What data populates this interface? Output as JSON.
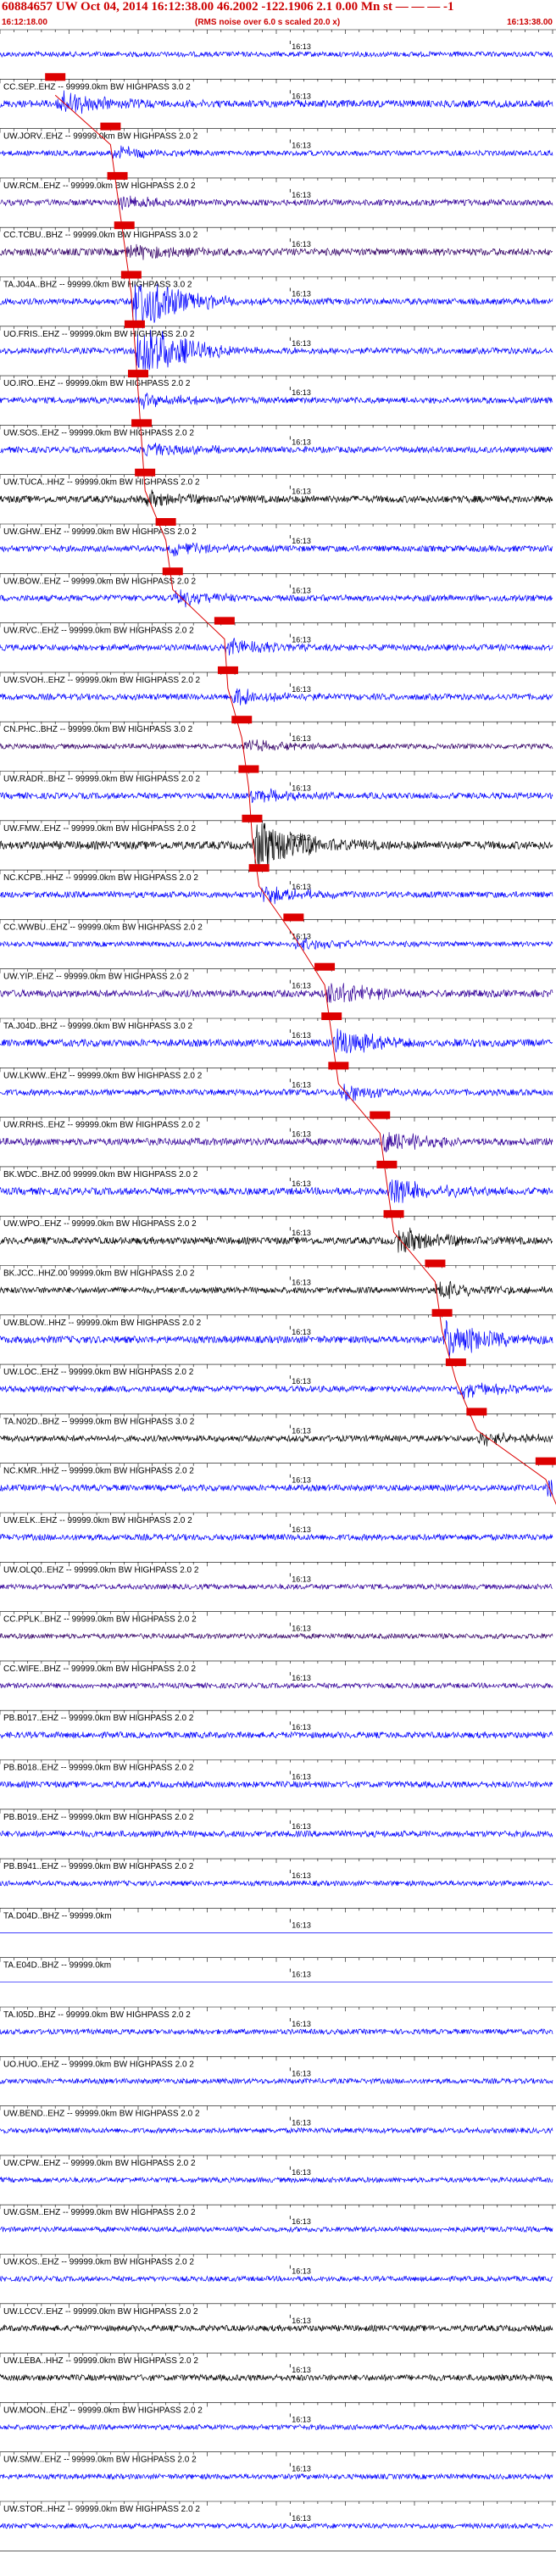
{
  "header": {
    "title": "60884657 UW Oct 04, 2014 16:12:38.00   46.2002 -122.1906  2.1 0.00 Mn st — — — -1",
    "start_time": "16:12:18.00",
    "rms_note": "(RMS noise over 6.0 s scaled 20.0 x)",
    "end_time": "16:13:38.00"
  },
  "chart_data": {
    "type": "line",
    "time_marker_label": "16:13",
    "x_range_seconds": [
      0,
      80
    ],
    "traces": [
      {
        "label": "",
        "color": "#0000ff",
        "amp": 0.25,
        "pick": null,
        "event": 0.9
      },
      {
        "label": "CC.SEP..EHZ -- 99999.0km BW  HIGHPASS  3.0  2",
        "color": "#0000ff",
        "amp": 0.35,
        "pick": 8.0,
        "event": 1.2
      },
      {
        "label": "UW.JORV..EHZ -- 99999.0km BW  HIGHPASS  2.0  2",
        "color": "#0000ff",
        "amp": 0.25,
        "pick": 16.0,
        "event": 0.7
      },
      {
        "label": "UW.RCM..EHZ -- 99999.0km BW  HIGHPASS  2.0  2",
        "color": "#330099",
        "amp": 0.3,
        "pick": 17.0,
        "event": 0.6
      },
      {
        "label": "CC.TCBU..BHZ -- 99999.0km BW  HIGHPASS  3.0  2",
        "color": "#330066",
        "amp": 0.35,
        "pick": 18.0,
        "event": 0.8
      },
      {
        "label": "TA.J04A..BHZ -- 99999.0km BW  HIGHPASS  3.0  2",
        "color": "#0000ff",
        "amp": 0.3,
        "pick": 19.0,
        "event": 3.0
      },
      {
        "label": "UO.FRIS..EHZ -- 99999.0km BW  HIGHPASS  2.0  2",
        "color": "#0000ff",
        "amp": 0.3,
        "pick": 19.5,
        "event": 3.0
      },
      {
        "label": "UO.IRO..EHZ -- 99999.0km BW  HIGHPASS  2.0  2",
        "color": "#0000ff",
        "amp": 0.3,
        "pick": 20.0,
        "event": 0.7
      },
      {
        "label": "UW.SOS..EHZ -- 99999.0km BW  HIGHPASS  2.0  2",
        "color": "#0000ff",
        "amp": 0.3,
        "pick": 20.5,
        "event": 0.8
      },
      {
        "label": "UW.TUCA..HHZ -- 99999.0km BW  HIGHPASS  2.0  2",
        "color": "#000000",
        "amp": 0.35,
        "pick": 21.0,
        "event": 0.8
      },
      {
        "label": "UW.GHW..EHZ -- 99999.0km BW  HIGHPASS  2.0  2",
        "color": "#0000ff",
        "amp": 0.3,
        "pick": 24.0,
        "event": 0.7
      },
      {
        "label": "UW.BOW..EHZ -- 99999.0km BW  HIGHPASS  2.0  2",
        "color": "#0000ff",
        "amp": 0.3,
        "pick": 25.0,
        "event": 0.8
      },
      {
        "label": "UW.RVC..EHZ -- 99999.0km BW  HIGHPASS  2.0  2",
        "color": "#0000ff",
        "amp": 0.3,
        "pick": 32.5,
        "event": 0.8
      },
      {
        "label": "UW.SVOH..EHZ -- 99999.0km BW  HIGHPASS  2.0  2",
        "color": "#0000ff",
        "amp": 0.3,
        "pick": 33.0,
        "event": 0.8
      },
      {
        "label": "CN.PHC..BHZ -- 99999.0km BW  HIGHPASS  3.0  2",
        "color": "#330066",
        "amp": 0.25,
        "pick": 35.0,
        "event": 0.6
      },
      {
        "label": "UW.RADR..BHZ -- 99999.0km BW  HIGHPASS  2.0  2",
        "color": "#0000ff",
        "amp": 0.3,
        "pick": 36.0,
        "event": 0.7
      },
      {
        "label": "UW.FMW..EHZ -- 99999.0km BW  HIGHPASS  2.0  2",
        "color": "#000000",
        "amp": 0.4,
        "pick": 36.5,
        "event": 2.8
      },
      {
        "label": "NC.KCPB..HHZ -- 99999.0km BW  HIGHPASS  2.0  2",
        "color": "#0000ff",
        "amp": 0.3,
        "pick": 37.5,
        "event": 0.8
      },
      {
        "label": "CC.WWBU..EHZ -- 99999.0km BW  HIGHPASS  2.0  2",
        "color": "#0000ff",
        "amp": 0.25,
        "pick": 42.5,
        "event": 0.6
      },
      {
        "label": "UW.YIP..EHZ -- 99999.0km BW  HIGHPASS  2.0  2",
        "color": "#330099",
        "amp": 0.35,
        "pick": 47.0,
        "event": 1.1
      },
      {
        "label": "TA.J04D..BHZ -- 99999.0km BW  HIGHPASS  3.0  2",
        "color": "#0000ff",
        "amp": 0.35,
        "pick": 48.0,
        "event": 1.4
      },
      {
        "label": "UW.LKWW..EHZ -- 99999.0km BW  HIGHPASS  2.0  2",
        "color": "#0000ff",
        "amp": 0.3,
        "pick": 49.0,
        "event": 0.8
      },
      {
        "label": "UW.RRHS..EHZ -- 99999.0km BW  HIGHPASS  2.0  2",
        "color": "#330099",
        "amp": 0.35,
        "pick": 55.0,
        "event": 1.1
      },
      {
        "label": "BK.WDC..BHZ.00 99999.0km BW  HIGHPASS  2.0  2",
        "color": "#0000ff",
        "amp": 0.35,
        "pick": 56.0,
        "event": 1.3
      },
      {
        "label": "UW.WPO..EHZ -- 99999.0km BW  HIGHPASS  2.0  2",
        "color": "#000000",
        "amp": 0.35,
        "pick": 57.0,
        "event": 1.4
      },
      {
        "label": "BK.JCC..HHZ.00 99999.0km BW  HIGHPASS  2.0  2",
        "color": "#000000",
        "amp": 0.3,
        "pick": 63.0,
        "event": 0.9
      },
      {
        "label": "UW.BLOW..HHZ -- 99999.0km BW  HIGHPASS  2.0  2",
        "color": "#0000ff",
        "amp": 0.35,
        "pick": 64.0,
        "event": 1.8
      },
      {
        "label": "UW.LOC..EHZ -- 99999.0km BW  HIGHPASS  2.0  2",
        "color": "#0000ff",
        "amp": 0.3,
        "pick": 66.0,
        "event": 0.8
      },
      {
        "label": "TA.N02D..BHZ -- 99999.0km BW  HIGHPASS  3.0  2",
        "color": "#000000",
        "amp": 0.3,
        "pick": 69.0,
        "event": 0.7
      },
      {
        "label": "NC.KMR..HHZ -- 99999.0km BW  HIGHPASS  2.0  2",
        "color": "#0000ff",
        "amp": 0.3,
        "pick": 79.0,
        "event": 1.0
      },
      {
        "label": "UW.ELK..EHZ -- 99999.0km BW  HIGHPASS  2.0  2",
        "color": "#0000ff",
        "amp": 0.3,
        "pick": 82.0,
        "event": 1.0
      },
      {
        "label": "UW.OLQ0..EHZ -- 99999.0km BW  HIGHPASS  2.0  2",
        "color": "#330099",
        "amp": 0.25,
        "pick": null,
        "event": 0.5
      },
      {
        "label": "CC.PPLK..BHZ -- 99999.0km BW  HIGHPASS  2.0  2",
        "color": "#330066",
        "amp": 0.25,
        "pick": null,
        "event": 0.5
      },
      {
        "label": "CC.WIFE..BHZ -- 99999.0km BW  HIGHPASS  2.0  2",
        "color": "#330099",
        "amp": 0.25,
        "pick": null,
        "event": 0.5
      },
      {
        "label": "PB.B017..EHZ -- 99999.0km BW  HIGHPASS  2.0  2",
        "color": "#0000ff",
        "amp": 0.3,
        "pick": null,
        "event": 0.5
      },
      {
        "label": "PB.B018..EHZ -- 99999.0km BW  HIGHPASS  2.0  2",
        "color": "#0000ff",
        "amp": 0.3,
        "pick": null,
        "event": 0.7
      },
      {
        "label": "PB.B019..EHZ -- 99999.0km BW  HIGHPASS  2.0  2",
        "color": "#0000ff",
        "amp": 0.3,
        "pick": null,
        "event": 0.5
      },
      {
        "label": "PB.B941..EHZ -- 99999.0km BW  HIGHPASS  2.0  2",
        "color": "#0000ff",
        "amp": 0.25,
        "pick": null,
        "event": 0.5
      },
      {
        "label": "TA.D04D..BHZ -- 99999.0km",
        "color": "#0000ff",
        "amp": 0.0,
        "pick": null,
        "event": 0
      },
      {
        "label": "TA.E04D..BHZ -- 99999.0km",
        "color": "#0000ff",
        "amp": 0.0,
        "pick": null,
        "event": 0
      },
      {
        "label": "TA.I05D..BHZ -- 99999.0km BW  HIGHPASS  2.0  2",
        "color": "#0000ff",
        "amp": 0.25,
        "pick": null,
        "event": 3.0
      },
      {
        "label": "UO.HUO..EHZ -- 99999.0km BW  HIGHPASS  2.0  2",
        "color": "#0000ff",
        "amp": 0.25,
        "pick": null,
        "event": 0.6
      },
      {
        "label": "UW.BEND..EHZ -- 99999.0km BW  HIGHPASS  2.0  2",
        "color": "#0000ff",
        "amp": 0.25,
        "pick": null,
        "event": 0.5
      },
      {
        "label": "UW.CPW..EHZ -- 99999.0km BW  HIGHPASS  2.0  2",
        "color": "#0000ff",
        "amp": 0.25,
        "pick": null,
        "event": 0.5
      },
      {
        "label": "UW.GSM..EHZ -- 99999.0km BW  HIGHPASS  2.0  2",
        "color": "#0000ff",
        "amp": 0.25,
        "pick": null,
        "event": 0.5
      },
      {
        "label": "UW.KOS..EHZ -- 99999.0km BW  HIGHPASS  2.0  2",
        "color": "#0000ff",
        "amp": 0.25,
        "pick": null,
        "event": 0.5
      },
      {
        "label": "UW.LCCV..EHZ -- 99999.0km BW  HIGHPASS  2.0  2",
        "color": "#000000",
        "amp": 0.3,
        "pick": null,
        "event": 0.5
      },
      {
        "label": "UW.LEBA..HHZ -- 99999.0km BW  HIGHPASS  2.0  2",
        "color": "#000000",
        "amp": 0.3,
        "pick": null,
        "event": 0.5
      },
      {
        "label": "UW.MOON..EHZ -- 99999.0km BW  HIGHPASS  2.0  2",
        "color": "#0000ff",
        "amp": 0.25,
        "pick": null,
        "event": 0.5
      },
      {
        "label": "UW.SMW..EHZ -- 99999.0km BW  HIGHPASS  2.0  2",
        "color": "#0000ff",
        "amp": 0.25,
        "pick": null,
        "event": 0.5
      },
      {
        "label": "UW.STOR..HHZ -- 99999.0km BW  HIGHPASS  2.0  2",
        "color": "#0000ff",
        "amp": 0.25,
        "pick": null,
        "event": 0.5
      }
    ]
  }
}
